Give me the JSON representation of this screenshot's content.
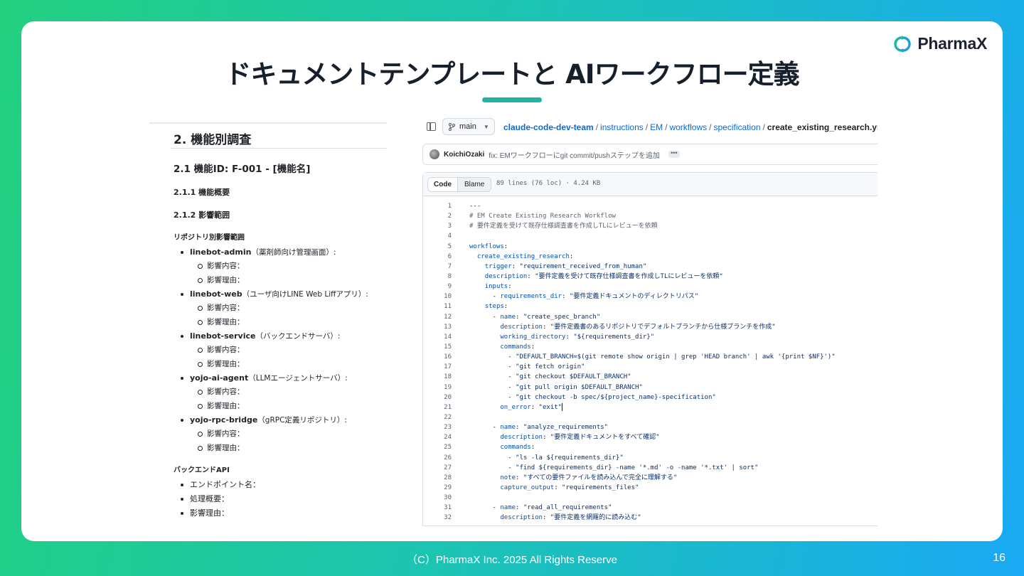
{
  "slide": {
    "title": "ドキュメントテンプレートと AIワークフロー定義",
    "brand": "PharmaX",
    "footer": "（C）PharmaX Inc. 2025  All Rights Reserve",
    "page_number": "16",
    "colors": {
      "accent": "#1fb4a3",
      "link": "#0969da"
    }
  },
  "doc": {
    "h2": "2. 機能別調査",
    "h3": "2.1 機能ID: F-001 - [機能名]",
    "h4_overview": "2.1.1 機能概要",
    "h4_impact": "2.1.2 影響範囲",
    "repo_heading": "リポジトリ別影響範囲",
    "repos": [
      {
        "name": "linebot-admin",
        "note": "（薬剤師向け管理画面）:",
        "items": [
          "影響内容：",
          "影響理由："
        ]
      },
      {
        "name": "linebot-web",
        "note": "（ユーザ向けLINE Web Liffアプリ）:",
        "items": [
          "影響内容：",
          "影響理由："
        ]
      },
      {
        "name": "linebot-service",
        "note": "（バックエンドサーバ）:",
        "items": [
          "影響内容：",
          "影響理由："
        ]
      },
      {
        "name": "yojo-ai-agent",
        "note": "（LLMエージェントサーバ）:",
        "items": [
          "影響内容：",
          "影響理由："
        ]
      },
      {
        "name": "yojo-rpc-bridge",
        "note": "（gRPC定義リポジトリ）:",
        "items": [
          "影響内容：",
          "影響理由："
        ]
      }
    ],
    "api_heading": "バックエンドAPI",
    "api_items": [
      "エンドポイント名：",
      "処理概要：",
      "影響理由："
    ]
  },
  "github": {
    "branch": "main",
    "breadcrumb": {
      "repo": "claude-code-dev-team",
      "path": [
        "instructions",
        "EM",
        "workflows",
        "specification"
      ],
      "file": "create_existing_research.yml"
    },
    "commit": {
      "author": "KoichiOzaki",
      "message": "fix: EMワークフローにgit commit/pushステップを追加",
      "more": "•••"
    },
    "tabs": {
      "code": "Code",
      "blame": "Blame"
    },
    "file_stats": "89 lines (76 loc) · 4.24 KB",
    "code_lines": [
      "---",
      "# EM Create Existing Research Workflow",
      "# 要件定義を受けて既存仕様調査書を作成しTLにレビューを依頼",
      "",
      "workflows:",
      "  create_existing_research:",
      "    trigger: \"requirement_received_from_human\"",
      "    description: \"要件定義を受けて既存仕様調査書を作成しTLにレビューを依頼\"",
      "    inputs:",
      "      - requirements_dir: \"要件定義ドキュメントのディレクトリパス\"",
      "    steps:",
      "      - name: \"create_spec_branch\"",
      "        description: \"要件定義書のあるリポジトリでデフォルトブランチから仕様ブランチを作成\"",
      "        working_directory: \"${requirements_dir}\"",
      "        commands:",
      "          - \"DEFAULT_BRANCH=$(git remote show origin | grep 'HEAD branch' | awk '{print $NF}')\"",
      "          - \"git fetch origin\"",
      "          - \"git checkout $DEFAULT_BRANCH\"",
      "          - \"git pull origin $DEFAULT_BRANCH\"",
      "          - \"git checkout -b spec/${project_name}-specification\"",
      "        on_error: \"exit\"",
      "",
      "      - name: \"analyze_requirements\"",
      "        description: \"要件定義ドキュメントをすべて確認\"",
      "        commands:",
      "          - \"ls -la ${requirements_dir}\"",
      "          - \"find ${requirements_dir} -name '*.md' -o -name '*.txt' | sort\"",
      "        note: \"すべての要件ファイルを読み込んで完全に理解する\"",
      "        capture_output: \"requirements_files\"",
      "",
      "      - name: \"read_all_requirements\"",
      "        description: \"要件定義を網羅的に読み込む\""
    ]
  }
}
